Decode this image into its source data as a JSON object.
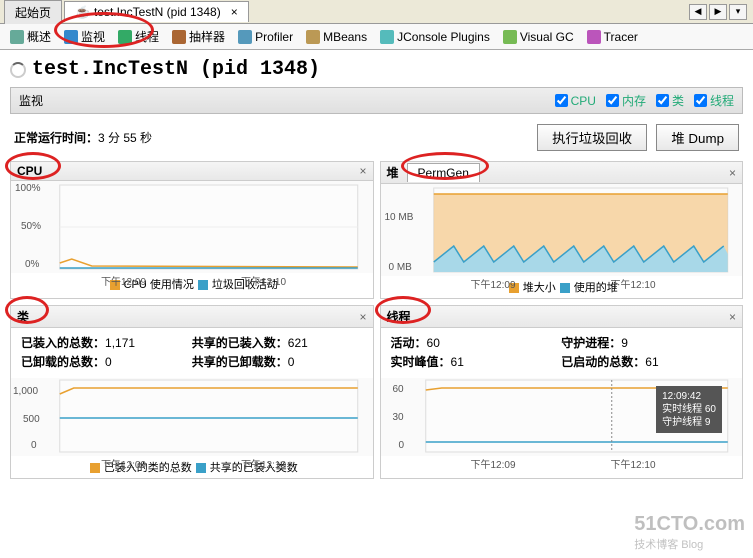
{
  "topTabs": {
    "start": "起始页",
    "active": "test.IncTestN (pid 1348)",
    "close": "×"
  },
  "toolbar": {
    "overview": "概述",
    "monitor": "监视",
    "threads": "线程",
    "sampler": "抽样器",
    "profiler": "Profiler",
    "mbeans": "MBeans",
    "jconsole": "JConsole Plugins",
    "visualgc": "Visual GC",
    "tracer": "Tracer"
  },
  "title": "test.IncTestN (pid 1348)",
  "panelLabel": "监视",
  "checks": {
    "cpu": "CPU",
    "mem": "内存",
    "classes": "类",
    "threads": "线程"
  },
  "uptime": {
    "label": "正常运行时间：",
    "value": "3 分 55 秒"
  },
  "buttons": {
    "gc": "执行垃圾回收",
    "dump": "堆 Dump"
  },
  "xTicks": {
    "t1": "下午12:09",
    "t2": "下午12:10"
  },
  "cpu": {
    "title": "CPU",
    "c": "×",
    "y100": "100%",
    "y50": "50%",
    "y0": "0%",
    "leg1": "CPU 使用情况",
    "leg2": "垃圾回收活动"
  },
  "heap": {
    "title": "堆",
    "tab": "PermGen",
    "c": "×",
    "y10": "10 MB",
    "y0": "0 MB",
    "leg1": "堆大小",
    "leg2": "使用的堆"
  },
  "classes": {
    "title": "类",
    "c": "×",
    "loaded": "已装入的总数：",
    "loadedV": "1,171",
    "unloaded": "已卸载的总数：",
    "unloadedV": "0",
    "shLoaded": "共享的已装入数：",
    "shLoadedV": "621",
    "shUnloaded": "共享的已卸载数：",
    "shUnloadedV": "0",
    "y1000": "1,000",
    "y500": "500",
    "y0": "0",
    "leg1": "已装入的类的总数",
    "leg2": "共享的已装入类数"
  },
  "threads": {
    "title": "线程",
    "c": "×",
    "live": "活动：",
    "liveV": "60",
    "peak": "实时峰值：",
    "peakV": "61",
    "daemon": "守护进程：",
    "daemonV": "9",
    "started": "已启动的总数：",
    "startedV": "61",
    "y60": "60",
    "y30": "30",
    "y0": "0",
    "tip1": "12:09:42",
    "tip2": "实时线程  60",
    "tip3": "守护线程  9"
  },
  "watermark": {
    "main": "51CTO.com",
    "sub": "技术博客 Blog"
  },
  "chart_data": [
    {
      "type": "line",
      "title": "CPU",
      "ylim": [
        0,
        100
      ],
      "x": [
        "12:09",
        "12:10"
      ],
      "series": [
        {
          "name": "CPU 使用情况",
          "values": [
            5,
            3,
            2,
            2,
            2,
            2
          ]
        },
        {
          "name": "垃圾回收活动",
          "values": [
            0,
            0,
            0,
            0,
            0,
            0
          ]
        }
      ]
    },
    {
      "type": "area",
      "title": "堆 PermGen",
      "ylim": [
        0,
        15
      ],
      "ylabel": "MB",
      "x": [
        "12:09",
        "12:10"
      ],
      "series": [
        {
          "name": "堆大小",
          "values": [
            13,
            13,
            13,
            13,
            13,
            13,
            13,
            13,
            13,
            13
          ]
        },
        {
          "name": "使用的堆",
          "values": [
            2,
            4,
            2,
            4,
            2,
            4,
            2,
            4,
            2,
            4
          ]
        }
      ]
    },
    {
      "type": "line",
      "title": "类",
      "ylim": [
        0,
        1200
      ],
      "x": [
        "12:09",
        "12:10"
      ],
      "series": [
        {
          "name": "已装入的类的总数",
          "values": [
            1100,
            1171,
            1171,
            1171,
            1171,
            1171
          ]
        },
        {
          "name": "共享的已装入类数",
          "values": [
            621,
            621,
            621,
            621,
            621,
            621
          ]
        }
      ]
    },
    {
      "type": "line",
      "title": "线程",
      "ylim": [
        0,
        65
      ],
      "x": [
        "12:09",
        "12:10"
      ],
      "series": [
        {
          "name": "活动",
          "values": [
            58,
            60,
            60,
            60,
            60,
            60
          ]
        },
        {
          "name": "守护进程",
          "values": [
            9,
            9,
            9,
            9,
            9,
            9
          ]
        }
      ]
    }
  ]
}
